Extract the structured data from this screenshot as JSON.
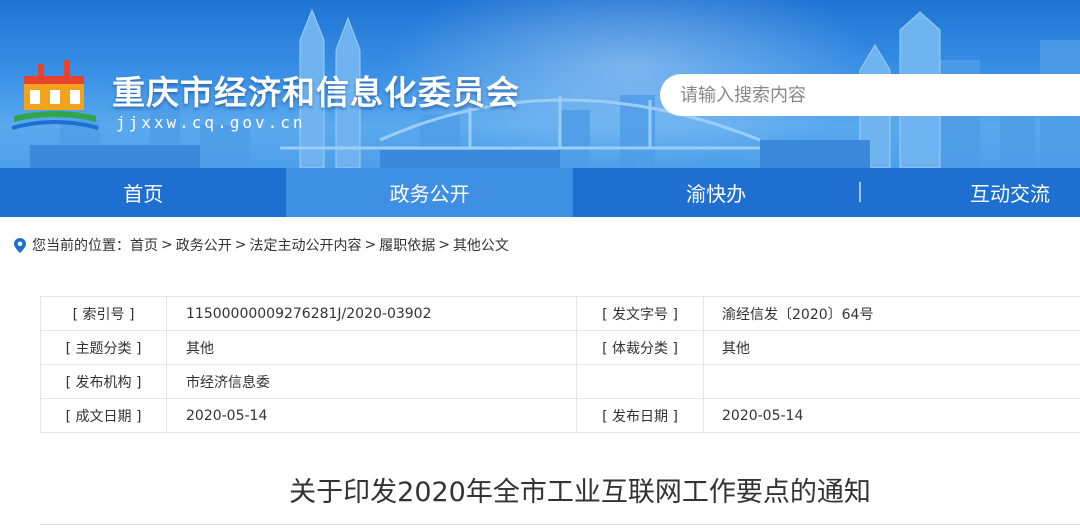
{
  "header": {
    "site_title": "重庆市经济和信息化委员会",
    "site_domain": "jjxxw.cq.gov.cn",
    "search_placeholder": "请输入搜索内容",
    "colors": {
      "banner": "#2a82dd",
      "nav": "#1e6fd0",
      "nav_active": "#3f8fe3"
    }
  },
  "nav": {
    "items": [
      {
        "label": "首页",
        "active": false
      },
      {
        "label": "政务公开",
        "active": true
      },
      {
        "label": "渝快办",
        "active": false
      },
      {
        "label": "互动交流",
        "active": false
      }
    ]
  },
  "breadcrumb": {
    "icon": "location-pin-icon",
    "prefix": "您当前的位置：",
    "items": [
      "首页",
      "政务公开",
      "法定主动公开内容",
      "履职依据",
      "其他公文"
    ],
    "separator": ">"
  },
  "meta": {
    "rows": [
      {
        "k1": "[ 索引号 ]",
        "v1": "11500000009276281J/2020-03902",
        "k2": "[ 发文字号 ]",
        "v2": "渝经信发〔2020〕64号"
      },
      {
        "k1": "[ 主题分类 ]",
        "v1": "其他",
        "k2": "[ 体裁分类 ]",
        "v2": "其他"
      },
      {
        "k1": "[ 发布机构 ]",
        "v1": "市经济信息委",
        "k2": "",
        "v2": ""
      },
      {
        "k1": "[ 成文日期 ]",
        "v1": "2020-05-14",
        "k2": "[ 发布日期 ]",
        "v2": "2020-05-14"
      }
    ]
  },
  "document": {
    "title": "关于印发2020年全市工业互联网工作要点的通知"
  }
}
